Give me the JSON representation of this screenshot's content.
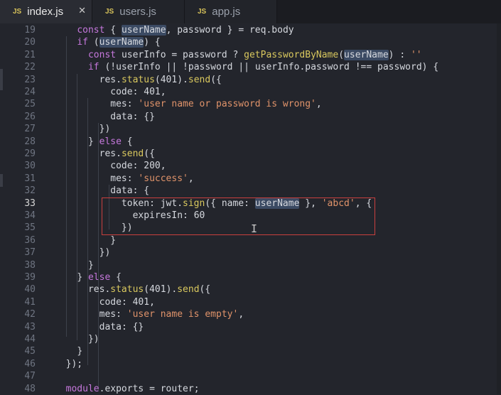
{
  "tabs": [
    {
      "badge": "JS",
      "label": "index.js",
      "active": true,
      "close": "✕"
    },
    {
      "badge": "JS",
      "label": "users.js",
      "active": false,
      "close": ""
    },
    {
      "badge": "JS",
      "label": "app.js",
      "active": false,
      "close": ""
    }
  ],
  "lines": [
    {
      "n": "19",
      "code": "    const { userName, password } = req.body"
    },
    {
      "n": "20",
      "code": "    if (userName) {"
    },
    {
      "n": "21",
      "code": "      const userInfo = password ? getPasswordByName(userName) : ''"
    },
    {
      "n": "22",
      "code": "      if (!userInfo || !password || userInfo.password !== password) {"
    },
    {
      "n": "23",
      "code": "        res.status(401).send({"
    },
    {
      "n": "24",
      "code": "          code: 401,"
    },
    {
      "n": "25",
      "code": "          mes: 'user name or password is wrong',"
    },
    {
      "n": "26",
      "code": "          data: {}"
    },
    {
      "n": "27",
      "code": "        })"
    },
    {
      "n": "28",
      "code": "      } else {"
    },
    {
      "n": "29",
      "code": "        res.send({"
    },
    {
      "n": "30",
      "code": "          code: 200,"
    },
    {
      "n": "31",
      "code": "          mes: 'success',"
    },
    {
      "n": "32",
      "code": "          data: {"
    },
    {
      "n": "33",
      "code": "            token: jwt.sign({ name: userName }, 'abcd', {"
    },
    {
      "n": "34",
      "code": "              expiresIn: 60"
    },
    {
      "n": "35",
      "code": "            })"
    },
    {
      "n": "36",
      "code": "          }"
    },
    {
      "n": "37",
      "code": "        })"
    },
    {
      "n": "38",
      "code": "      }"
    },
    {
      "n": "39",
      "code": "    } else {"
    },
    {
      "n": "40",
      "code": "      res.status(401).send({"
    },
    {
      "n": "41",
      "code": "        code: 401,"
    },
    {
      "n": "42",
      "code": "        mes: 'user name is empty',"
    },
    {
      "n": "43",
      "code": "        data: {}"
    },
    {
      "n": "44",
      "code": "      })"
    },
    {
      "n": "45",
      "code": "    }"
    },
    {
      "n": "46",
      "code": "  });"
    },
    {
      "n": "47",
      "code": ""
    },
    {
      "n": "48",
      "code": "  module.exports = router;"
    }
  ],
  "current_line": "33",
  "colors": {
    "background": "#23252c",
    "highlight_box": "#c9403e",
    "keyword": "#c678dd",
    "string": "#e0936a",
    "function": "#d9c85e"
  },
  "icons": {
    "tab_badge": "js-file-icon",
    "close": "close-icon",
    "cursor": "text-cursor-icon"
  }
}
